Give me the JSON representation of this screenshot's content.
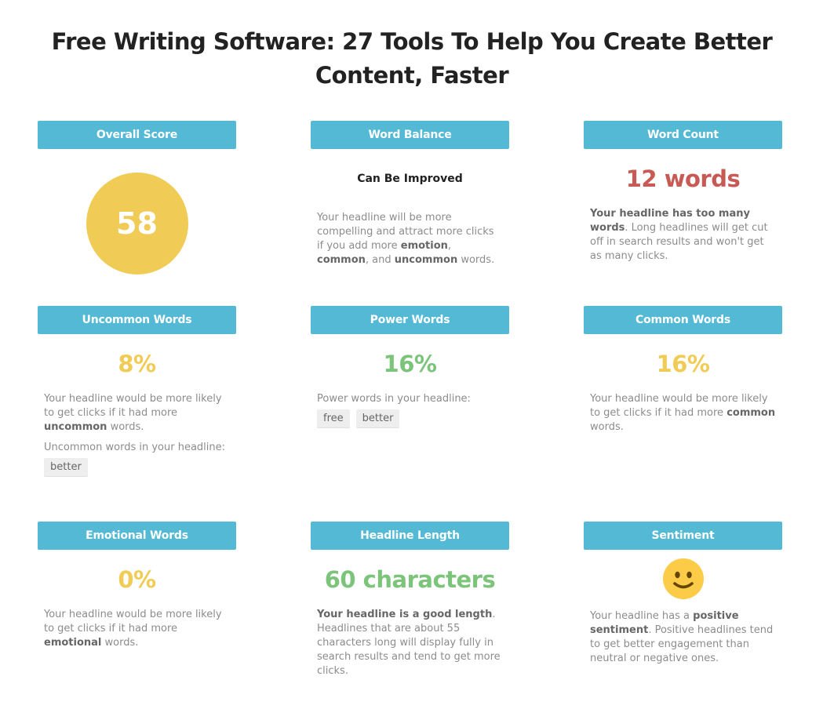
{
  "page": {
    "title": "Free Writing Software: 27 Tools To Help You Create Better Content, Faster"
  },
  "colors": {
    "header_bg": "#53b9d4",
    "score_yellow": "#f0cc56",
    "warn_red": "#c75a55",
    "good_green": "#7bc47a",
    "mid_yellow": "#f0cc56"
  },
  "cards": {
    "overall_score": {
      "title": "Overall Score",
      "value": "58"
    },
    "word_balance": {
      "title": "Word Balance",
      "status": "Can Be Improved",
      "desc_1": "Your headline will be more compelling and attract more clicks if you add more ",
      "bold_1": "emotion",
      "desc_2": ", ",
      "bold_2": "common",
      "desc_3": ", and ",
      "bold_3": "uncommon",
      "desc_4": " words."
    },
    "word_count": {
      "title": "Word Count",
      "value": "12 words",
      "bold": "Your headline has too many words",
      "desc": ". Long headlines will get cut off in search results and won't get as many clicks."
    },
    "uncommon_words": {
      "title": "Uncommon Words",
      "value": "8%",
      "desc_1": "Your headline would be more likely to get clicks if it had more ",
      "bold": "uncommon",
      "desc_2": " words.",
      "list_label": "Uncommon words in your headline:",
      "tags": [
        "better"
      ]
    },
    "power_words": {
      "title": "Power Words",
      "value": "16%",
      "list_label": "Power words in your headline:",
      "tags": [
        "free",
        "better"
      ]
    },
    "common_words": {
      "title": "Common Words",
      "value": "16%",
      "desc_1": "Your headline would be more likely to get clicks if it had more ",
      "bold": "common",
      "desc_2": " words."
    },
    "emotional_words": {
      "title": "Emotional Words",
      "value": "0%",
      "desc_1": "Your headline would be more likely to get clicks if it had more ",
      "bold": "emotional",
      "desc_2": " words."
    },
    "headline_length": {
      "title": "Headline Length",
      "value": "60 characters",
      "bold": "Your headline is a good length",
      "desc": ". Headlines that are about 55 characters long will display fully in search results and tend to get more clicks."
    },
    "sentiment": {
      "title": "Sentiment",
      "icon": "smiley-face-icon",
      "desc_1": "Your headline has a ",
      "bold": "positive sentiment",
      "desc_2": ". Positive headlines tend to get better engagement than neutral or negative ones."
    }
  }
}
